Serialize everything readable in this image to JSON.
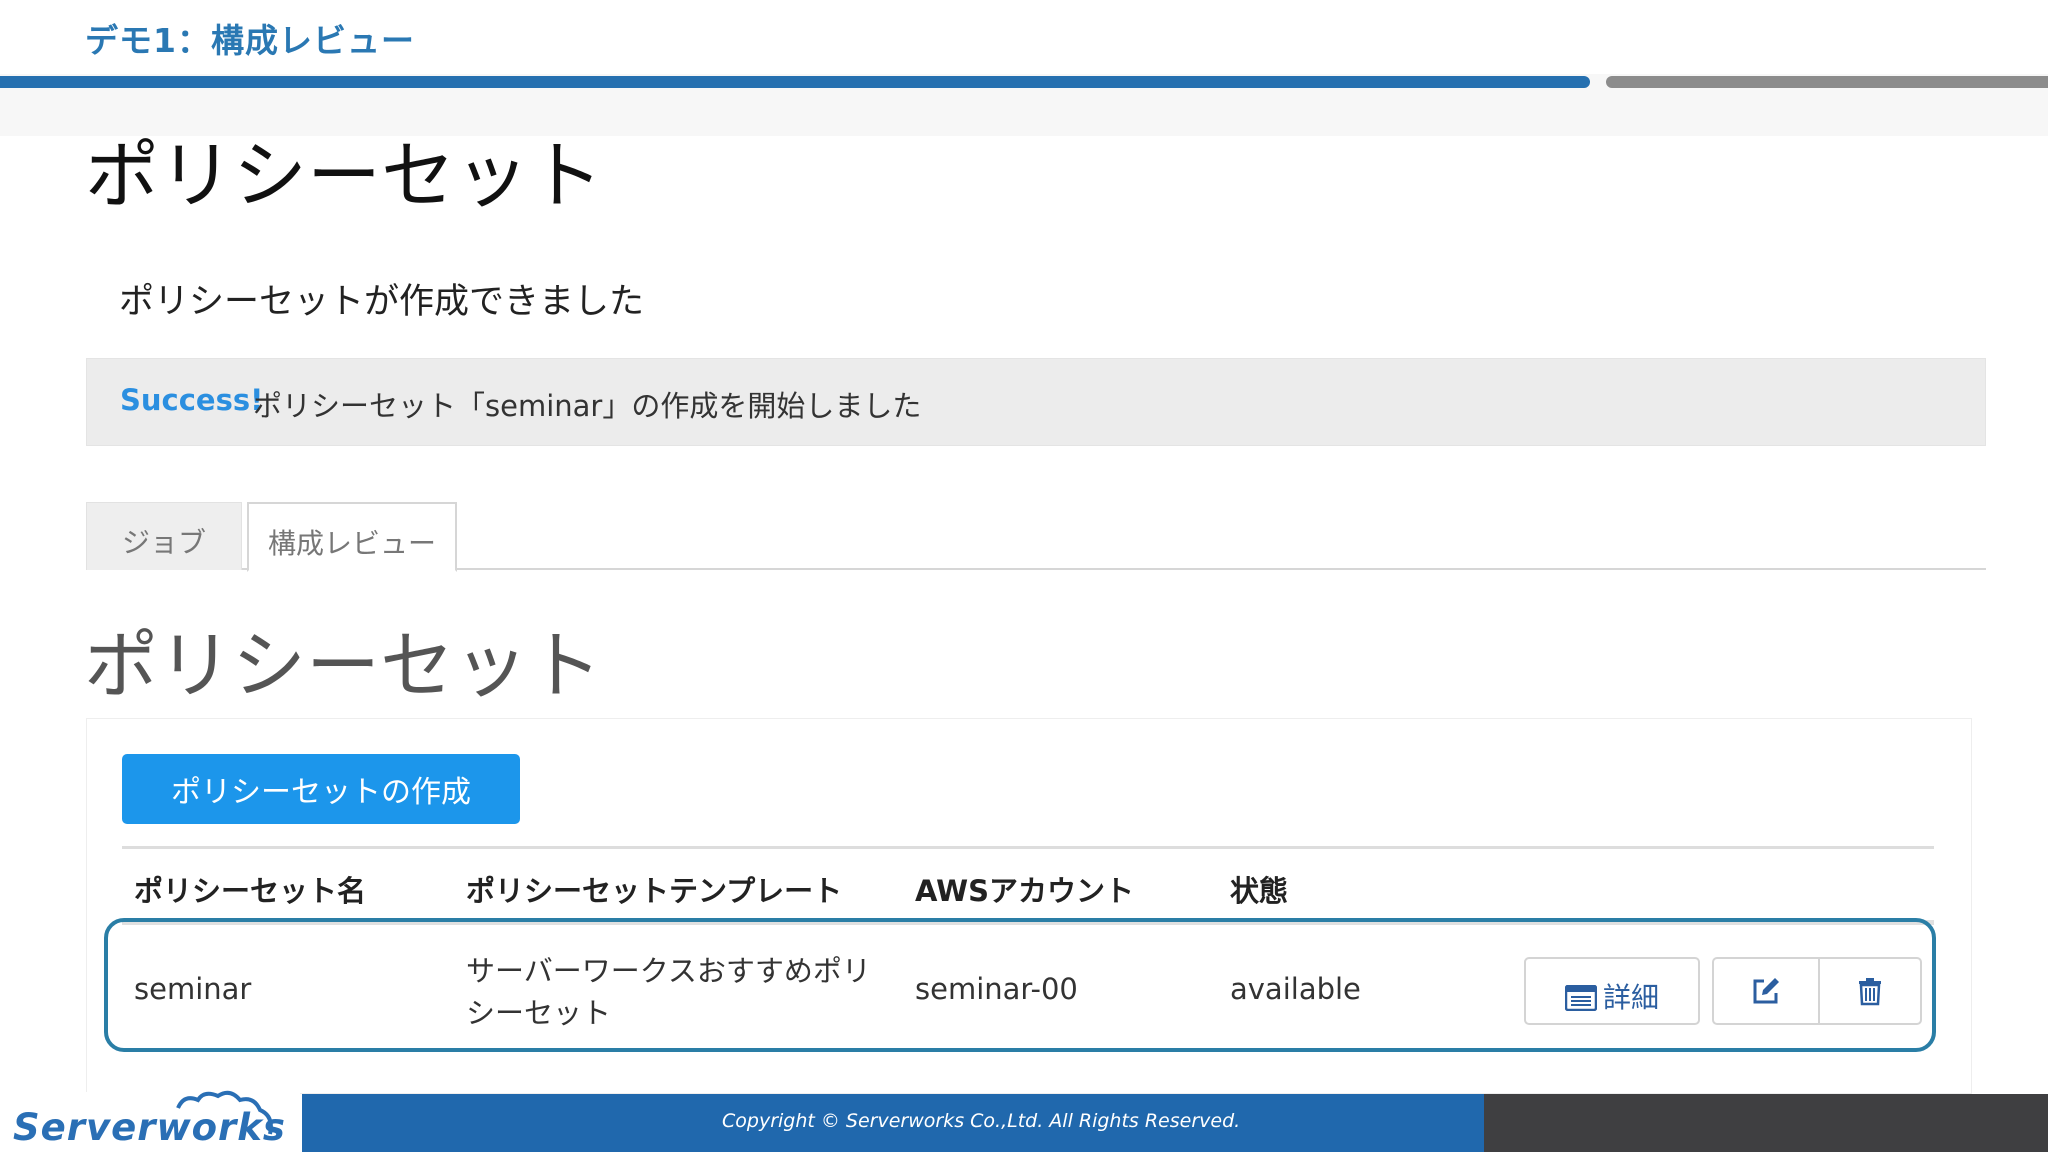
{
  "slide": {
    "title": "デモ1：構成レビュー",
    "heading": "ポリシーセット",
    "subtext": "ポリシーセットが作成できました"
  },
  "alert": {
    "strong": "Success!",
    "message": "ポリシーセット「seminar」の作成を開始しました"
  },
  "tabs": [
    {
      "label": "ジョブ"
    },
    {
      "label": "構成レビュー"
    }
  ],
  "page": {
    "heading": "ポリシーセット",
    "create_button": "ポリシーセットの作成"
  },
  "table": {
    "columns": [
      "ポリシーセット名",
      "ポリシーセットテンプレート",
      "AWSアカウント",
      "状態"
    ],
    "rows": [
      {
        "name": "seminar",
        "template_line1": "サーバーワークスおすすめポリ",
        "template_line2": "シーセット",
        "account": "seminar-00",
        "status": "available",
        "detail_label": "詳細"
      }
    ]
  },
  "footer": {
    "copyright": "Copyright © Serverworks Co.,Ltd. All Rights Reserved.",
    "logo": "Serverworks"
  },
  "colors": {
    "accent_blue": "#2670b0",
    "button_blue": "#1c96eb",
    "success_blue": "#2b8fe0",
    "highlight_border": "#2a7ea6"
  }
}
